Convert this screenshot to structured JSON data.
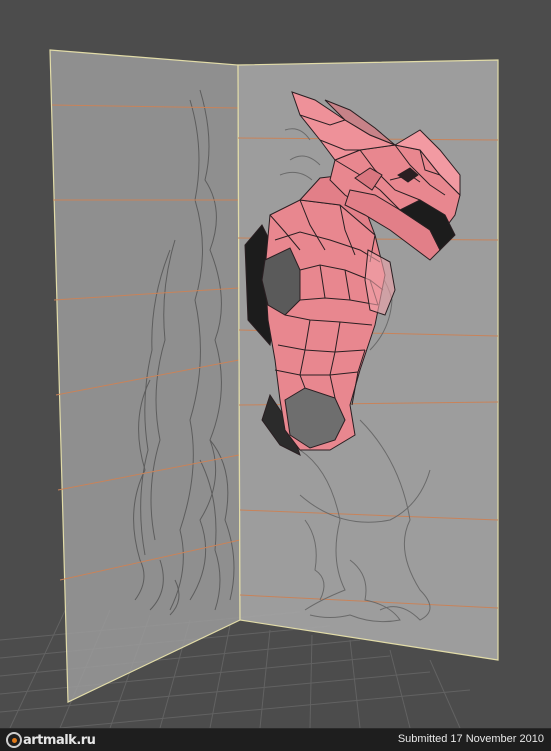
{
  "watermark": {
    "logo_text": "artmalk.ru"
  },
  "footer": {
    "submitted_text": "Submitted 17 November 2010"
  },
  "colors": {
    "viewport_bg": "#4c4c4c",
    "panel_fill": "#a9a9a9",
    "panel_edge": "#e2dca8",
    "mesh_fill": "#e8878f",
    "mesh_edge": "#2a1f22",
    "guide_line": "#c8835a",
    "grid": "#6a6a6a"
  }
}
